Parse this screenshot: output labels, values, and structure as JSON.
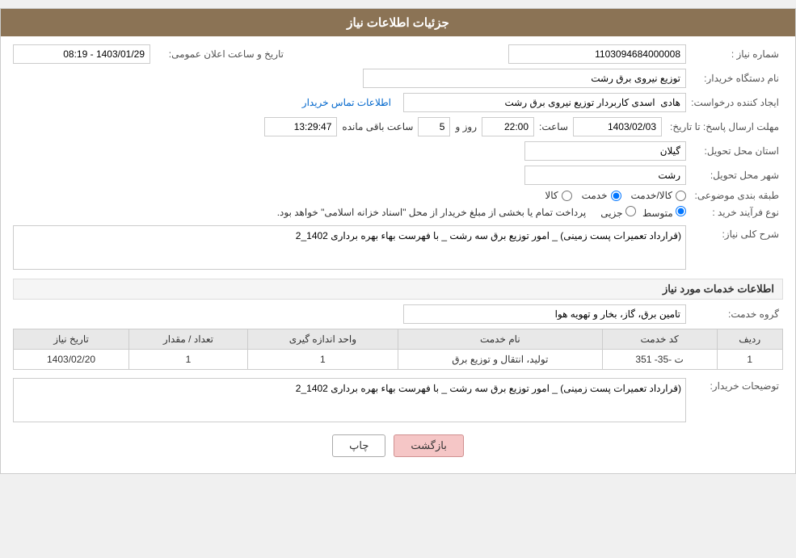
{
  "header": {
    "title": "جزئیات اطلاعات نیاز"
  },
  "form": {
    "shomareNiaz_label": "شماره نیاز :",
    "shomareNiaz_value": "1103094684000008",
    "tarikhElan_label": "تاریخ و ساعت اعلان عمومی:",
    "tarikhElan_value": "1403/01/29 - 08:19",
    "namDastgah_label": "نام دستگاه خریدار:",
    "namDastgah_value": "توزیع نیروی برق رشت",
    "ijadKonande_label": "ایجاد کننده درخواست:",
    "ijadKonande_value": "هادی  اسدی کاربردار توزیع نیروی برق رشت",
    "ettelaatTamas_link": "اطلاعات تماس خریدار",
    "mohlatErsalPasokh_label": "مهلت ارسال پاسخ: تا تاریخ:",
    "mohlatDate_value": "1403/02/03",
    "mohlatSaat_label": "ساعت:",
    "mohlatSaat_value": "22:00",
    "mohlatRoz_label": "روز و",
    "mohlatRoz_value": "5",
    "mohlatBaghiMande_label": "ساعت باقی مانده",
    "mohlatBaghiMande_value": "13:29:47",
    "ostan_label": "استان محل تحویل:",
    "ostan_value": "گیلان",
    "shahr_label": "شهر محل تحویل:",
    "shahr_value": "رشت",
    "tabaqeBandi_label": "طبقه بندی موضوعی:",
    "tabaqe_kala": "کالا",
    "tabaqe_khadamat": "خدمت",
    "tabaqe_kala_khadamat": "کالا/خدمت",
    "tabaqe_selected": "khadamat",
    "noeFarayand_label": "نوع فرآیند خرید :",
    "noeFarayand_jozii": "جزیی",
    "noeFarayand_mottaset": "متوسط",
    "noeFarayand_note": "پرداخت تمام یا بخشی از مبلغ خریدار از محل \"اسناد خزانه اسلامی\" خواهد بود.",
    "noeFarayand_selected": "mottaset",
    "sharhKolliNiaz_label": "شرح کلی نیاز:",
    "sharhKolliNiaz_value": "(قرارداد تعمیرات پست زمینی) _ امور توزیع برق سه رشت _ با فهرست بهاء بهره برداری 1402_2",
    "khadamatSection_title": "اطلاعات خدمات مورد نیاز",
    "groheKhadamat_label": "گروه خدمت:",
    "groheKhadamat_value": "تامین برق، گاز، بخار و تهویه هوا",
    "table": {
      "col_radif": "ردیف",
      "col_kodKhadamat": "کد خدمت",
      "col_namKhadamat": "نام خدمت",
      "col_vahedAndaze": "واحد اندازه گیری",
      "col_tedadMeqdar": "تعداد / مقدار",
      "col_tarikhNiaz": "تاریخ نیاز",
      "rows": [
        {
          "radif": "1",
          "kodKhadamat": "ت -35- 351",
          "namKhadamat": "تولید، انتقال و توزیع برق",
          "vahedAndaze": "1",
          "tedadMeqdar": "1",
          "tarikhNiaz": "1403/02/20"
        }
      ]
    },
    "tozihatKhardar_label": "توضیحات خریدار:",
    "tozihatKhardar_value": "(قرارداد تعمیرات پست زمینی) _ امور توزیع برق سه رشت _ با فهرست بهاء بهره برداری 1402_2",
    "btn_chap": "چاپ",
    "btn_bazgasht": "بازگشت"
  }
}
